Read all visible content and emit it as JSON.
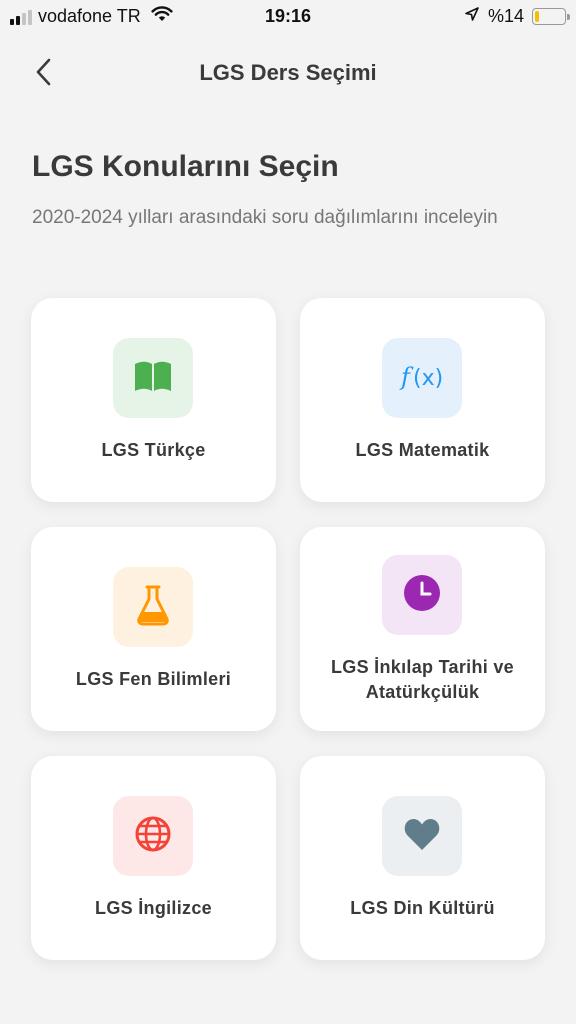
{
  "status_bar": {
    "carrier": "vodafone TR",
    "time": "19:16",
    "battery": "%14",
    "battery_level": 0.14,
    "battery_color": "#f2c200"
  },
  "nav": {
    "title": "LGS Ders Seçimi",
    "back_icon": "chevron-left-icon"
  },
  "header": {
    "title": "LGS Konularını Seçin",
    "subtitle": "2020-2024 yılları arasındaki soru dağılımlarını inceleyin"
  },
  "subjects": [
    {
      "label": "LGS Türkçe",
      "icon": "book-icon",
      "color": "#4caf50",
      "bg": "#e6f4e7"
    },
    {
      "label": "LGS Matematik",
      "icon": "function-icon",
      "color": "#2196f3",
      "bg": "#e4f1fd"
    },
    {
      "label": "LGS Fen Bilimleri",
      "icon": "flask-icon",
      "color": "#ff9800",
      "bg": "#fff1e0"
    },
    {
      "label": "LGS İnkılap Tarihi ve Atatürkçülük",
      "icon": "clock-icon",
      "color": "#9c27b0",
      "bg": "#f3e4f6"
    },
    {
      "label": "LGS İngilizce",
      "icon": "globe-icon",
      "color": "#f44336",
      "bg": "#fde8e7"
    },
    {
      "label": "LGS Din Kültürü",
      "icon": "heart-icon",
      "color": "#607d8b",
      "bg": "#ebeff1"
    }
  ]
}
